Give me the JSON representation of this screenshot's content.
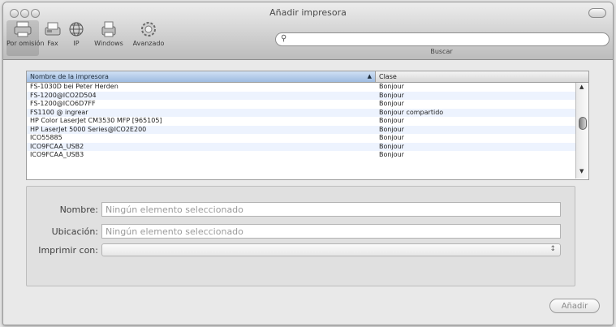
{
  "window": {
    "title": "Añadir impresora"
  },
  "toolbar": {
    "items": [
      {
        "label": "Por omisión",
        "icon": "default-printer-icon"
      },
      {
        "label": "Fax",
        "icon": "fax-icon"
      },
      {
        "label": "IP",
        "icon": "globe-icon"
      },
      {
        "label": "Windows",
        "icon": "windows-printer-icon"
      },
      {
        "label": "Avanzado",
        "icon": "gear-icon"
      }
    ],
    "search_placeholder": "",
    "search_label": "Buscar"
  },
  "table": {
    "columns": [
      "Nombre de la impresora",
      "Clase"
    ],
    "rows": [
      {
        "name": "FS-1030D bei Peter Herden",
        "class": "Bonjour"
      },
      {
        "name": "FS-1200@ICO2D504",
        "class": "Bonjour"
      },
      {
        "name": "FS-1200@ICO6D7FF",
        "class": "Bonjour"
      },
      {
        "name": "FS1100 @ ingrear",
        "class": "Bonjour compartido"
      },
      {
        "name": "HP Color LaserJet CM3530 MFP [965105]",
        "class": "Bonjour"
      },
      {
        "name": "HP LaserJet 5000 Series@ICO2E200",
        "class": "Bonjour"
      },
      {
        "name": "ICO55885",
        "class": "Bonjour"
      },
      {
        "name": "ICO9FCAA_USB2",
        "class": "Bonjour"
      },
      {
        "name": "ICO9FCAA_USB3",
        "class": "Bonjour"
      }
    ]
  },
  "details": {
    "name_label": "Nombre:",
    "name_value": "Ningún elemento seleccionado",
    "location_label": "Ubicación:",
    "location_value": "Ningún elemento seleccionado",
    "print_with_label": "Imprimir con:",
    "print_with_value": ""
  },
  "actions": {
    "add_label": "Añadir"
  }
}
